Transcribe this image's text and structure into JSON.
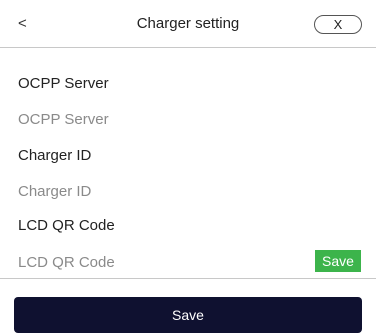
{
  "header": {
    "back_label": "<",
    "title": "Charger setting",
    "close_label": "X"
  },
  "form": {
    "ocpp_server": {
      "label": "OCPP Server",
      "placeholder": "OCPP Server",
      "value": ""
    },
    "charger_id": {
      "label": "Charger ID",
      "placeholder": "Charger ID",
      "value": ""
    },
    "lcd_qr_code": {
      "label": "LCD QR Code",
      "placeholder": "LCD QR Code",
      "value": "",
      "save_label": "Save"
    }
  },
  "footer": {
    "save_label": "Save"
  },
  "colors": {
    "inline_save_bg": "#3cb44b",
    "primary_button_bg": "#0f1130"
  }
}
